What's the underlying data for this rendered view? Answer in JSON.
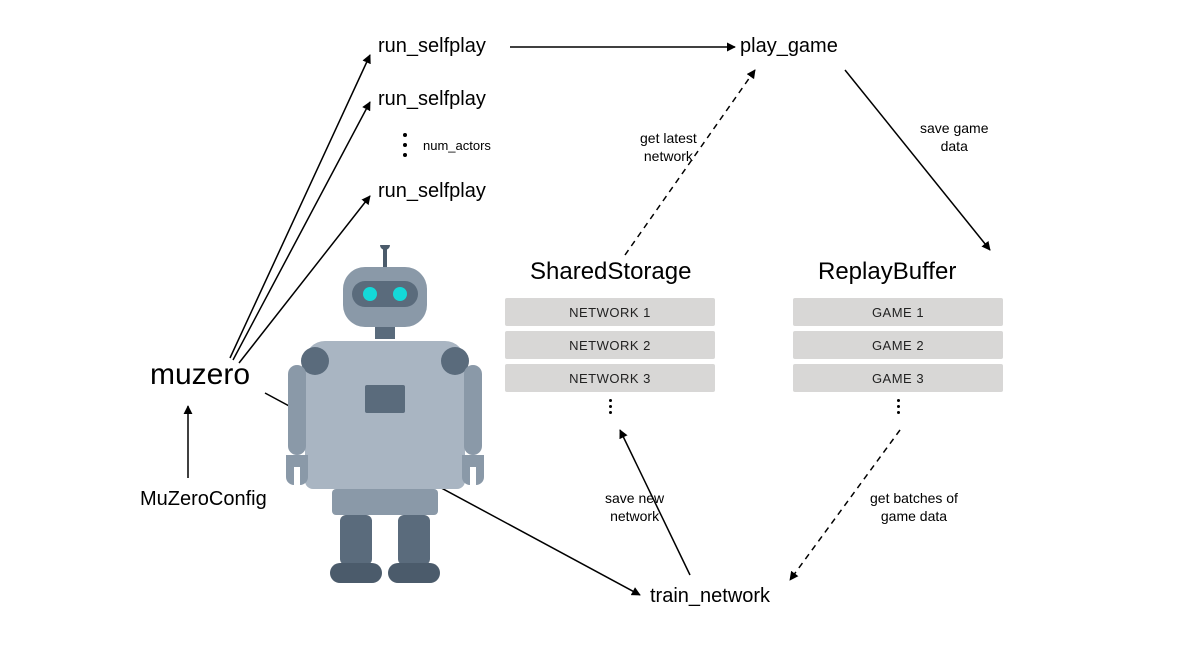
{
  "nodes": {
    "muzero": "muzero",
    "muzero_config": "MuZeroConfig",
    "run_selfplay_1": "run_selfplay",
    "run_selfplay_2": "run_selfplay",
    "run_selfplay_3": "run_selfplay",
    "num_actors": "num_actors",
    "play_game": "play_game",
    "train_network": "train_network",
    "shared_storage_title": "SharedStorage",
    "replay_buffer_title": "ReplayBuffer"
  },
  "edge_labels": {
    "get_latest_network": "get latest\nnetwork",
    "save_game_data": "save game\ndata",
    "save_new_network": "save new\nnetwork",
    "get_batches": "get batches of\ngame data"
  },
  "shared_storage": [
    "NETWORK 1",
    "NETWORK 2",
    "NETWORK 3"
  ],
  "replay_buffer": [
    "GAME 1",
    "GAME 2",
    "GAME 3"
  ]
}
